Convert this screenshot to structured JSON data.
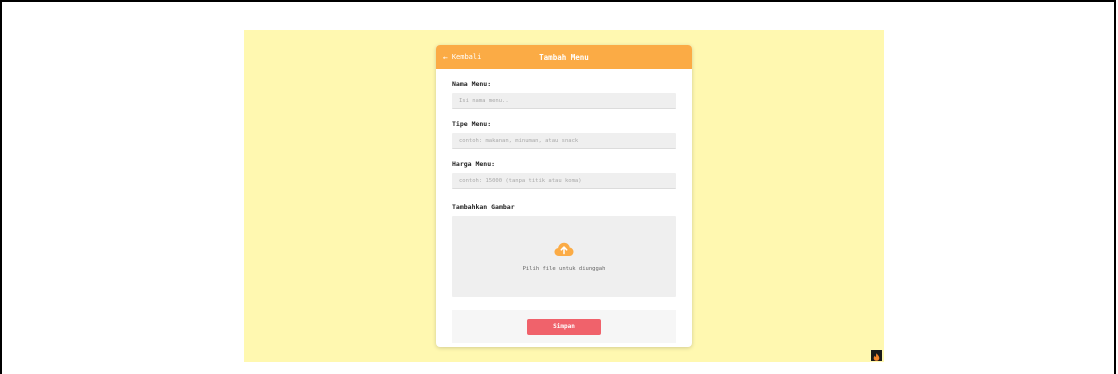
{
  "header": {
    "back_label": "Kembali",
    "title": "Tambah Menu"
  },
  "form": {
    "name": {
      "label": "Nama Menu:",
      "placeholder": "Isi nama menu..",
      "value": ""
    },
    "type": {
      "label": "Tipe Menu:",
      "placeholder": "contoh: makanan, minuman, atau snack",
      "value": ""
    },
    "price": {
      "label": "Harga Menu:",
      "placeholder": "contoh: 15000 (tanpa titik atau koma)",
      "value": ""
    },
    "upload": {
      "label": "Tambahkan Gambar",
      "text": "Pilih file untuk diunggah",
      "icon": "cloud-upload-icon"
    },
    "submit_label": "Simpan"
  },
  "colors": {
    "background": "#fff8b0",
    "header": "#fbab45",
    "submit": "#f0626b",
    "upload_icon": "#fbab45"
  },
  "corner_badge_icon": "flame-icon"
}
